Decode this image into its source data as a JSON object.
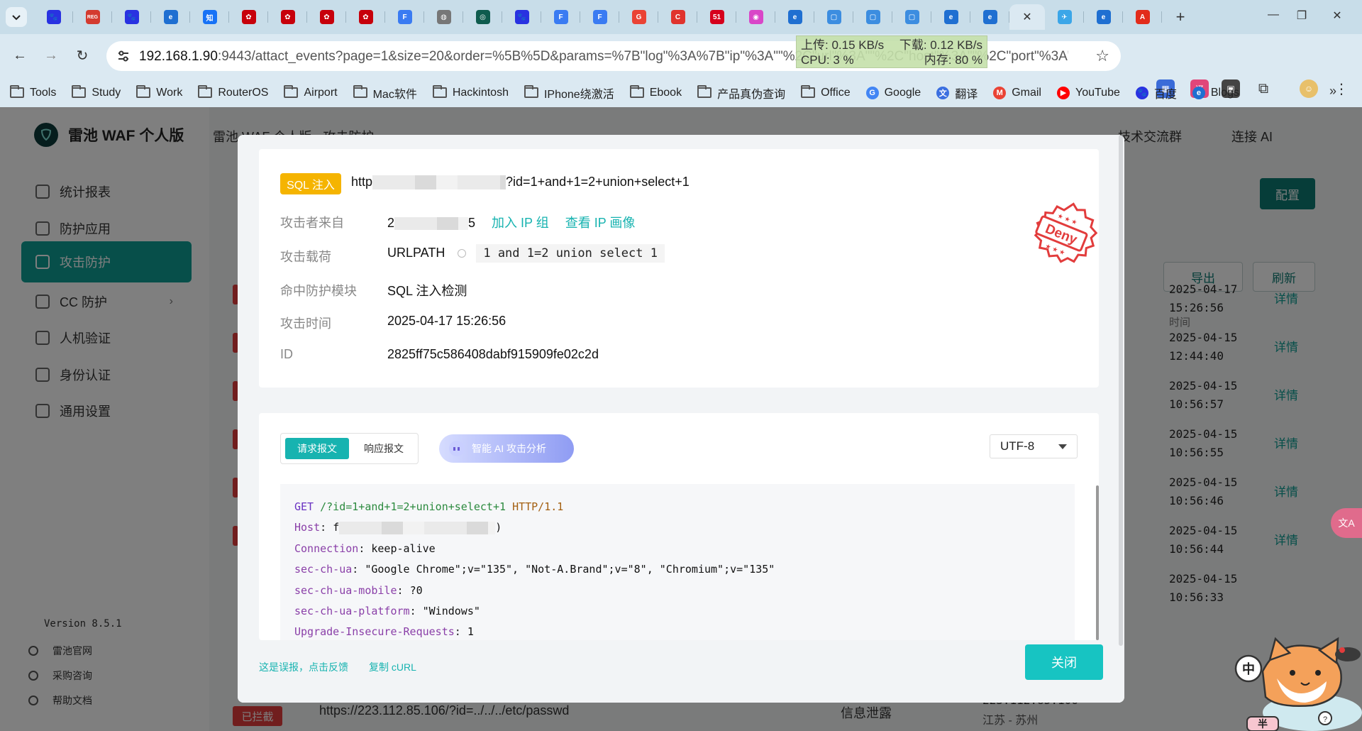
{
  "browser": {
    "tabs": [
      {
        "icon": "baidu-paw-icon",
        "color": "#2932e1",
        "glyph": "🐾"
      },
      {
        "icon": "reg-icon",
        "color": "#d43b2f",
        "glyph": "REG"
      },
      {
        "icon": "baidu-paw-icon",
        "color": "#2932e1",
        "glyph": "🐾"
      },
      {
        "icon": "edge-blue-icon",
        "color": "#1f6fd1",
        "glyph": "e"
      },
      {
        "icon": "zhihu-icon",
        "color": "#1772f6",
        "glyph": "知"
      },
      {
        "icon": "huawei-icon",
        "color": "#c7000b",
        "glyph": "✿"
      },
      {
        "icon": "huawei-icon",
        "color": "#c7000b",
        "glyph": "✿"
      },
      {
        "icon": "huawei-icon",
        "color": "#c7000b",
        "glyph": "✿"
      },
      {
        "icon": "huawei-icon",
        "color": "#c7000b",
        "glyph": "✿"
      },
      {
        "icon": "f-blue-icon",
        "color": "#3a7bf2",
        "glyph": "F"
      },
      {
        "icon": "globe-icon",
        "color": "#777777",
        "glyph": "◍"
      },
      {
        "icon": "compass-icon",
        "color": "#0f5c4e",
        "glyph": "◎"
      },
      {
        "icon": "baidu-paw-icon",
        "color": "#2932e1",
        "glyph": "🐾"
      },
      {
        "icon": "f-blue-icon",
        "color": "#3a7bf2",
        "glyph": "F"
      },
      {
        "icon": "f-blue-icon",
        "color": "#3a7bf2",
        "glyph": "F"
      },
      {
        "icon": "google-icon",
        "color": "#ea4335",
        "glyph": "G"
      },
      {
        "icon": "c-red-icon",
        "color": "#e0332d",
        "glyph": "C"
      },
      {
        "icon": "51-icon",
        "color": "#d6001c",
        "glyph": "51"
      },
      {
        "icon": "pink-circle-icon",
        "color": "#d946c8",
        "glyph": "◉"
      },
      {
        "icon": "edge-blue-icon",
        "color": "#1f6fd1",
        "glyph": "e"
      },
      {
        "icon": "tv-icon",
        "color": "#3c8de0",
        "glyph": "▢"
      },
      {
        "icon": "tv-icon",
        "color": "#3c8de0",
        "glyph": "▢"
      },
      {
        "icon": "tv-icon",
        "color": "#3c8de0",
        "glyph": "▢"
      },
      {
        "icon": "edge-blue-icon",
        "color": "#1f6fd1",
        "glyph": "e"
      },
      {
        "icon": "edge-blue-icon",
        "color": "#1f6fd1",
        "glyph": "e"
      },
      {
        "icon": "close-icon",
        "color": "#333333",
        "glyph": "✕",
        "active": true
      },
      {
        "icon": "bird-icon",
        "color": "#3ba6e8",
        "glyph": "✈"
      },
      {
        "icon": "edge-blue-icon",
        "color": "#1f6fd1",
        "glyph": "e"
      },
      {
        "icon": "adobe-icon",
        "color": "#e22c1b",
        "glyph": "A"
      }
    ],
    "url_host": "192.168.1.90",
    "url_rest": ":9443/attact_events?page=1&size=20&order=%5B%5D&params=%7B\"log\"%3A%7B\"ip\"%3A\"\"%2C\"url\"%3A\"\"%2C\"host\"%3A\"\"%2C\"port\"%3A\"%2...",
    "netmon": {
      "up": "上传: 0.15 KB/s",
      "down": "下载: 0.12 KB/s",
      "cpu": "CPU: 3 %",
      "mem": "内存: 80 %"
    },
    "bookmarks": [
      {
        "label": "Tools",
        "type": "folder"
      },
      {
        "label": "Study",
        "type": "folder"
      },
      {
        "label": "Work",
        "type": "folder"
      },
      {
        "label": "RouterOS",
        "type": "folder"
      },
      {
        "label": "Airport",
        "type": "folder"
      },
      {
        "label": "Mac软件",
        "type": "folder"
      },
      {
        "label": "Hackintosh",
        "type": "folder"
      },
      {
        "label": "IPhone绕激活",
        "type": "folder"
      },
      {
        "label": "Ebook",
        "type": "folder"
      },
      {
        "label": "产品真伪查询",
        "type": "folder"
      },
      {
        "label": "Office",
        "type": "folder"
      },
      {
        "label": "Google",
        "type": "site",
        "icon": "google-icon",
        "color": "#4285f4",
        "glyph": "G"
      },
      {
        "label": "翻译",
        "type": "site",
        "icon": "translate-icon",
        "color": "#3b6fe0",
        "glyph": "文"
      },
      {
        "label": "Gmail",
        "type": "site",
        "icon": "gmail-icon",
        "color": "#ea4335",
        "glyph": "M"
      },
      {
        "label": "YouTube",
        "type": "site",
        "icon": "youtube-icon",
        "color": "#ff0000",
        "glyph": "▶"
      },
      {
        "label": "百度",
        "type": "site",
        "icon": "baidu-paw-icon",
        "color": "#2932e1",
        "glyph": "🐾"
      },
      {
        "label": "Blogs",
        "type": "site",
        "icon": "blogs-icon",
        "color": "#1f6fd1",
        "glyph": "e"
      }
    ]
  },
  "app": {
    "brand": "雷池 WAF 个人版",
    "breadcrumb": "雷池 WAF 个人版  ›  攻击防护",
    "nav": [
      {
        "label": "统计报表"
      },
      {
        "label": "防护应用"
      },
      {
        "label": "攻击防护",
        "active": true
      },
      {
        "label": "CC 防护",
        "chev": "›"
      },
      {
        "label": "人机验证"
      },
      {
        "label": "身份认证"
      },
      {
        "label": "通用设置"
      }
    ],
    "version": "Version 8.5.1",
    "side_links": [
      "雷池官网",
      "采购咨询",
      "帮助文档"
    ],
    "header_right": {
      "community": "技术交流群",
      "connect_ai": "连接 AI"
    },
    "btn_config": "配置",
    "btn_export": "导出",
    "btn_refresh": "刷新",
    "col_time": "时间",
    "rows": [
      {
        "date": "2025-04-17",
        "time": "15:26:56"
      },
      {
        "date": "2025-04-15",
        "time": "12:44:40"
      },
      {
        "date": "2025-04-15",
        "time": "10:56:57"
      },
      {
        "date": "2025-04-15",
        "time": "10:56:55"
      },
      {
        "date": "2025-04-15",
        "time": "10:56:46"
      },
      {
        "date": "2025-04-15",
        "time": "10:56:44"
      },
      {
        "date": "2025-04-15",
        "time": "10:56:33"
      }
    ],
    "detail_label": "详情",
    "bottom_row": {
      "tag": "已拦截",
      "url": "https://223.112.85.106/?id=../../../etc/passwd",
      "type": "信息泄露",
      "ip": "223.112.85.106",
      "loc": "江苏 - 苏州"
    }
  },
  "modal": {
    "tag": "SQL 注入",
    "url_prefix": "http",
    "url_suffix": "?id=1+and+1=2+union+select+1",
    "source_label": "攻击者来自",
    "source_prefix": "2",
    "source_suffix": "5",
    "add_ip_group": "加入 IP 组",
    "view_ip_profile": "查看 IP 画像",
    "payload_label": "攻击载荷",
    "payload_type": "URLPATH",
    "payload_value": "1 and 1=2 union select 1",
    "module_label": "命中防护模块",
    "module_value": "SQL 注入检测",
    "time_label": "攻击时间",
    "time_value": "2025-04-17 15:26:56",
    "id_label": "ID",
    "id_value": "2825ff75c586408dabf915909fe02c2d",
    "stamp_text": "Deny",
    "tab_request": "请求报文",
    "tab_response": "响应报文",
    "ai_button": "智能 AI 攻击分析",
    "encoding": "UTF-8",
    "request_lines": [
      {
        "method": "GET",
        "path": "/?id=1+and+1=2+union+select+1",
        "proto": "HTTP/1.1"
      },
      {
        "k": "Host",
        "v": "f",
        "masked_tail": ")"
      },
      {
        "k": "Connection",
        "v": "keep-alive"
      },
      {
        "k": "sec-ch-ua",
        "v": "\"Google Chrome\";v=\"135\", \"Not-A.Brand\";v=\"8\", \"Chromium\";v=\"135\""
      },
      {
        "k": "sec-ch-ua-mobile",
        "v": "?0"
      },
      {
        "k": "sec-ch-ua-platform",
        "v": "\"Windows\""
      },
      {
        "k": "Upgrade-Insecure-Requests",
        "v": "1"
      }
    ],
    "false_positive": "这是误报，点击反馈",
    "copy_curl": "复制 cURL",
    "close": "关闭"
  },
  "floating": {
    "translate_fab": "文A",
    "mascot_badge_left": "中",
    "mascot_badge_bottom": "半"
  },
  "colors": {
    "teal": "#17b3b0",
    "dark_teal": "#0d7a73",
    "sql_tag": "#f5b400",
    "deny_red": "#e23c3c"
  }
}
